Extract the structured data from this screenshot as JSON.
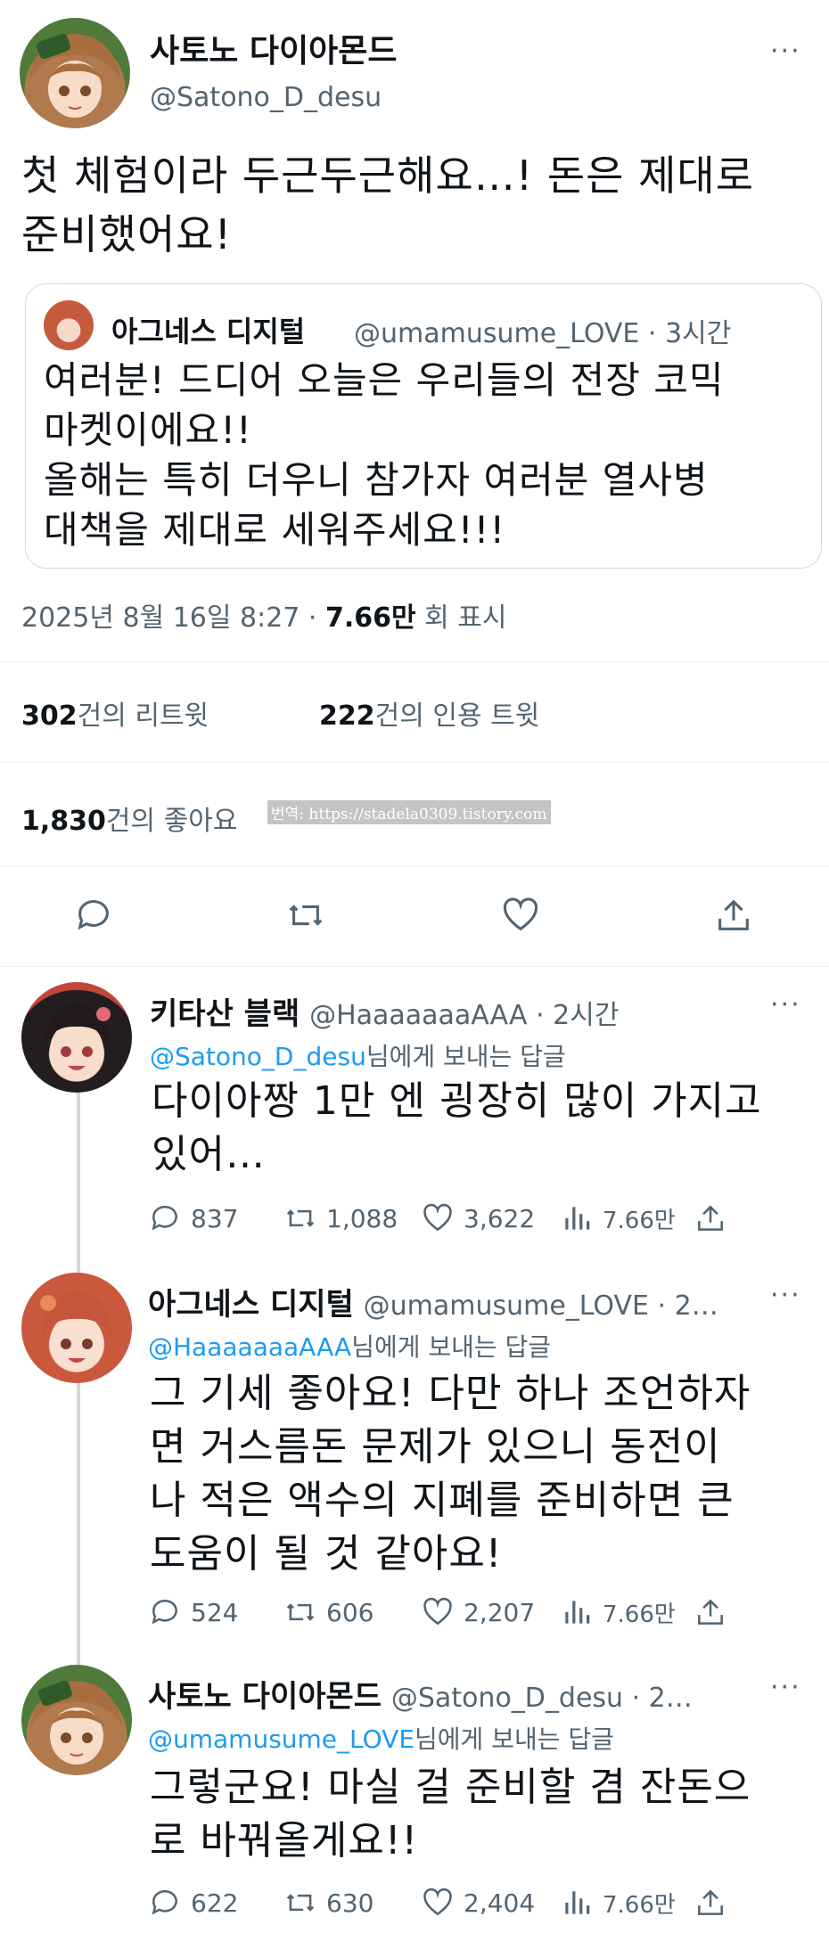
{
  "main": {
    "name": "사토노 다이아몬드",
    "handle": "@Satono_D_desu",
    "more": "···",
    "text_line1": "첫 체험이라 두근두근해요…! 돈은 제대로",
    "text_line2": "준비했어요!",
    "quote": {
      "name": "아그네스 디지털",
      "handle": "@umamusume_LOVE · 3시간",
      "lines": [
        "여러분! 드디어 오늘은 우리들의 전장 코믹",
        "마켓이에요!!",
        "올해는 특히 더우니 참가자 여러분 열사병",
        "대책을 제대로 세워주세요!!!"
      ]
    },
    "meta": {
      "date": "2025년 8월 16일  8:27 · ",
      "views": "7.66만",
      "views_label": " 회 표시"
    },
    "stats": {
      "retweets": "302",
      "retweets_label": "건의 리트윗",
      "quotes": "222",
      "quotes_label": "건의 인용 트윗",
      "likes": "1,830",
      "likes_label": "건의 좋아요",
      "watermark": "번역: https://stadela0309.tistory.com"
    }
  },
  "replies": [
    {
      "name": "키타산 블랙",
      "handle": "@HaaaaaaaAAA · 2시간",
      "more": "···",
      "reply_to": "@Satono_D_desu",
      "reply_suffix": "님에게 보내는 답글",
      "lines": [
        "다이아짱 1만 엔 굉장히 많이 가지고",
        "있어…"
      ],
      "replies": "837",
      "retweets": "1,088",
      "likes": "3,622",
      "views": "7.66만"
    },
    {
      "name": "아그네스 디지털",
      "handle": "@umamusume_LOVE · 2…",
      "more": "···",
      "reply_to": "@HaaaaaaaAAA",
      "reply_suffix": "님에게 보내는 답글",
      "lines": [
        "그 기세 좋아요! 다만 하나 조언하자",
        "면 거스름돈 문제가 있으니 동전이",
        "나 적은 액수의 지폐를 준비하면 큰",
        "도움이 될 것 같아요!"
      ],
      "replies": "524",
      "retweets": "606",
      "likes": "2,207",
      "views": "7.66만"
    },
    {
      "name": "사토노 다이아몬드",
      "handle": "@Satono_D_desu · 2…",
      "more": "···",
      "reply_to": "@umamusume_LOVE",
      "reply_suffix": "님에게 보내는 답글",
      "lines": [
        "그렇군요! 마실 걸 준비할 겸 잔돈으",
        "로 바꿔올게요!!"
      ],
      "replies": "622",
      "retweets": "630",
      "likes": "2,404",
      "views": "7.66만"
    }
  ]
}
